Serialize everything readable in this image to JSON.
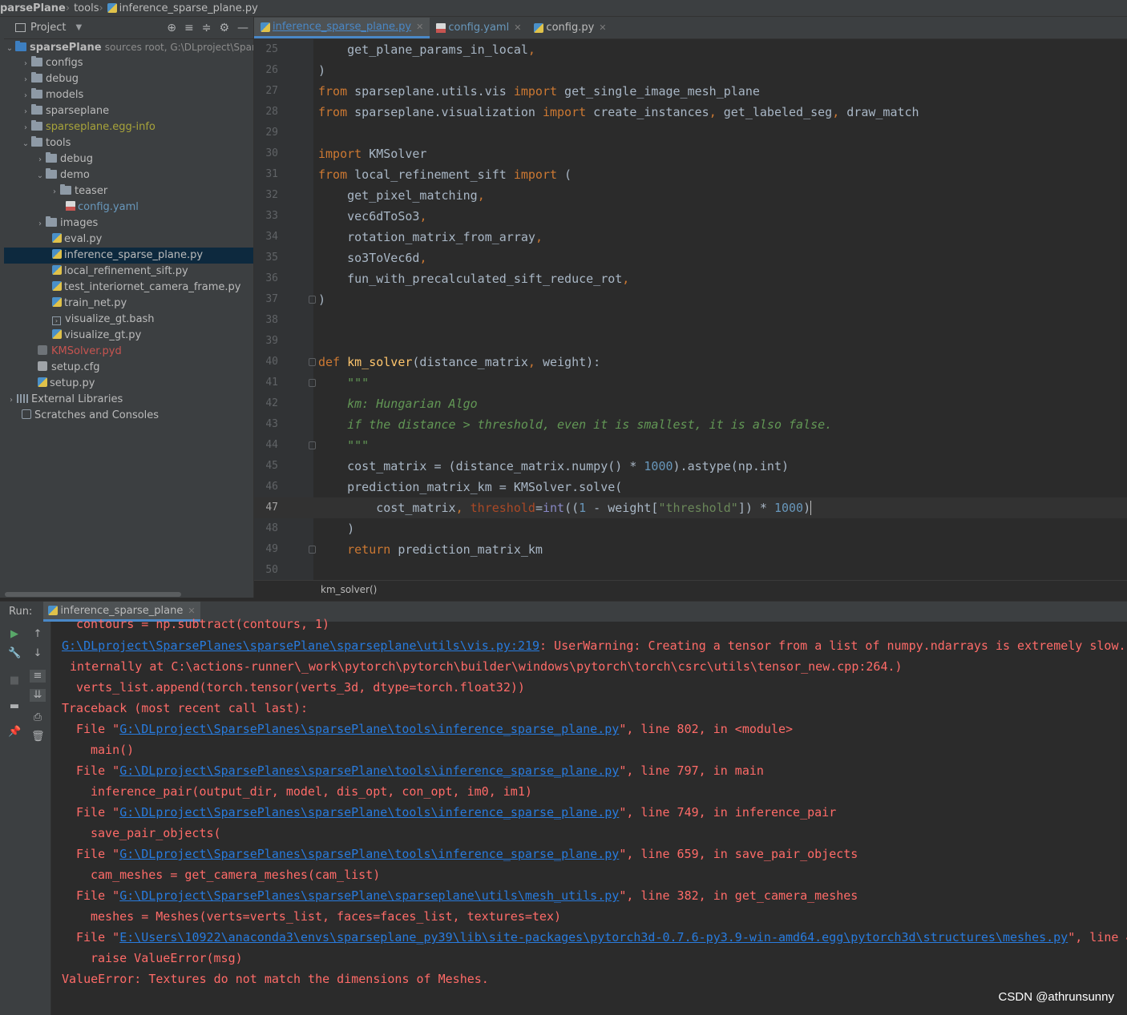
{
  "breadcrumb": {
    "project": "parsePlane",
    "folder": "tools",
    "file": "inference_sparse_plane.py"
  },
  "project_panel": {
    "title": "Project",
    "root_name": "sparsePlane",
    "root_note": "sources root,  G:\\DLproject\\Spars",
    "items": [
      {
        "label": "configs"
      },
      {
        "label": "debug"
      },
      {
        "label": "models"
      },
      {
        "label": "sparseplane"
      },
      {
        "label": "sparseplane.egg-info"
      },
      {
        "label": "tools"
      },
      {
        "label": "debug"
      },
      {
        "label": "demo"
      },
      {
        "label": "teaser"
      },
      {
        "label": "config.yaml"
      },
      {
        "label": "images"
      },
      {
        "label": "eval.py"
      },
      {
        "label": "inference_sparse_plane.py"
      },
      {
        "label": "local_refinement_sift.py"
      },
      {
        "label": "test_interiornet_camera_frame.py"
      },
      {
        "label": "train_net.py"
      },
      {
        "label": "visualize_gt.bash"
      },
      {
        "label": "visualize_gt.py"
      },
      {
        "label": "KMSolver.pyd"
      },
      {
        "label": "setup.cfg"
      },
      {
        "label": "setup.py"
      },
      {
        "label": "External Libraries"
      },
      {
        "label": "Scratches and Consoles"
      }
    ]
  },
  "editor_tabs": [
    {
      "label": "inference_sparse_plane.py"
    },
    {
      "label": "config.yaml"
    },
    {
      "label": "config.py"
    }
  ],
  "line_numbers": [
    "25",
    "26",
    "27",
    "28",
    "29",
    "30",
    "31",
    "32",
    "33",
    "34",
    "35",
    "36",
    "37",
    "38",
    "39",
    "40",
    "41",
    "42",
    "43",
    "44",
    "45",
    "46",
    "47",
    "48",
    "49",
    "50"
  ],
  "editor_breadcrumb": "km_solver()",
  "run": {
    "label": "Run:",
    "tab": "inference_sparse_plane",
    "console": {
      "path1": "G:\\DLproject\\SparsePlanes\\sparsePlane\\tools\\inference_sparse_plane.py",
      "path_vis": "G:\\DLproject\\SparsePlanes\\sparsePlane\\sparseplane\\utils\\vis.py:219",
      "path_mesh_utils": "G:\\DLproject\\SparsePlanes\\sparsePlane\\sparseplane\\utils\\mesh_utils.py",
      "path_meshes": "E:\\Users\\10922\\anaconda3\\envs\\sparseplane_py39\\lib\\site-packages\\pytorch3d-0.7.6-py3.9-win-amd64.egg\\pytorch3d\\structures\\meshes.py"
    }
  },
  "watermark": "CSDN @athrunsunny"
}
